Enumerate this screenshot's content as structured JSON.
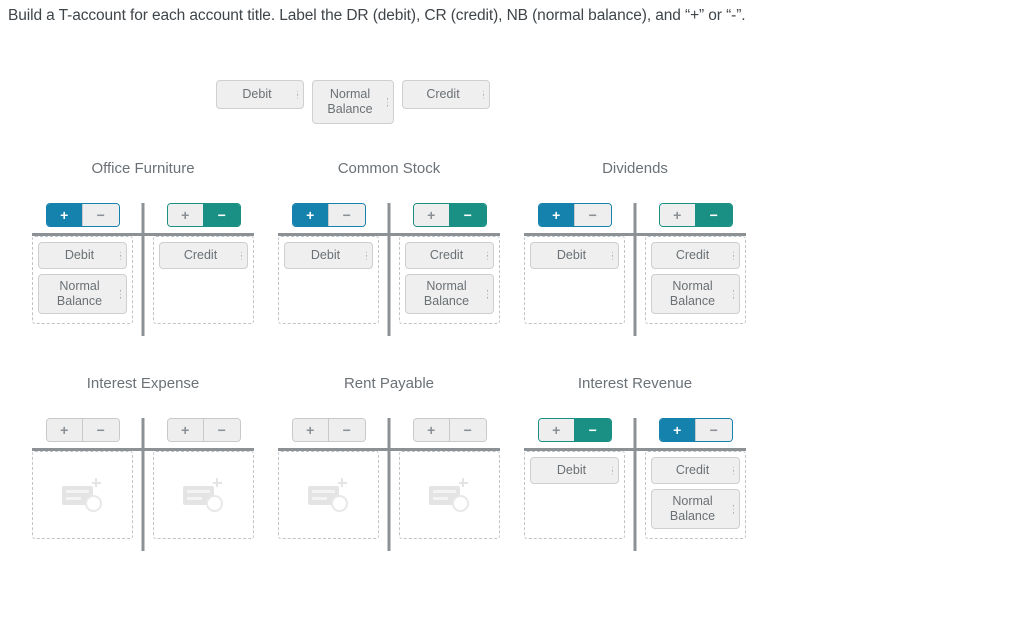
{
  "instruction": "Build a T-account for each account title. Label the DR (debit), CR (credit), NB (normal balance), and “+” or “-”.",
  "colors": {
    "debit_selected": "#1581ad",
    "credit_selected": "#199083",
    "neutral_fill": "#eeeeee",
    "neutral_text": "#8a9095",
    "rule": "#8c9195",
    "token_fill": "#efefef",
    "token_border": "#cfcfcf",
    "dropzone_border": "#c0c4c7"
  },
  "token_bank": {
    "name": "token-bank",
    "tokens": [
      {
        "label": "Debit",
        "two_line": false
      },
      {
        "label": "Normal\nBalance",
        "line1": "Normal",
        "line2": "Balance",
        "two_line": true
      },
      {
        "label": "Credit",
        "two_line": false
      }
    ]
  },
  "toggle": {
    "plus_label": "+",
    "minus_label": "−"
  },
  "placeholder": {
    "icon": "add-token-placeholder-icon"
  },
  "accounts": [
    {
      "title": "Office Furniture",
      "debit": {
        "plus_state": "selected-blue",
        "minus_state": "neutral",
        "tokens": [
          {
            "label": "Debit",
            "two_line": false
          },
          {
            "label": "Normal Balance",
            "line1": "Normal",
            "line2": "Balance",
            "two_line": true
          }
        ]
      },
      "credit": {
        "plus_state": "neutral",
        "minus_state": "selected-teal",
        "tokens": [
          {
            "label": "Credit",
            "two_line": false
          }
        ]
      }
    },
    {
      "title": "Common Stock",
      "debit": {
        "plus_state": "selected-blue",
        "minus_state": "neutral",
        "tokens": [
          {
            "label": "Debit",
            "two_line": false
          }
        ]
      },
      "credit": {
        "plus_state": "neutral",
        "minus_state": "selected-teal",
        "tokens": [
          {
            "label": "Credit",
            "two_line": false
          },
          {
            "label": "Normal Balance",
            "line1": "Normal",
            "line2": "Balance",
            "two_line": true
          }
        ]
      }
    },
    {
      "title": "Dividends",
      "debit": {
        "plus_state": "selected-blue",
        "minus_state": "neutral",
        "tokens": [
          {
            "label": "Debit",
            "two_line": false
          }
        ]
      },
      "credit": {
        "plus_state": "neutral",
        "minus_state": "selected-teal",
        "tokens": [
          {
            "label": "Credit",
            "two_line": false
          },
          {
            "label": "Normal Balance",
            "line1": "Normal",
            "line2": "Balance",
            "two_line": true
          }
        ]
      }
    },
    {
      "title": "Interest Expense",
      "debit": {
        "plus_state": "neutral",
        "minus_state": "neutral",
        "tokens": []
      },
      "credit": {
        "plus_state": "neutral",
        "minus_state": "neutral",
        "tokens": []
      }
    },
    {
      "title": "Rent Payable",
      "debit": {
        "plus_state": "neutral",
        "minus_state": "neutral",
        "tokens": []
      },
      "credit": {
        "plus_state": "neutral",
        "minus_state": "neutral",
        "tokens": []
      }
    },
    {
      "title": "Interest Revenue",
      "debit": {
        "plus_state": "neutral",
        "minus_state": "selected-teal",
        "tokens": [
          {
            "label": "Debit",
            "two_line": false
          }
        ]
      },
      "credit": {
        "plus_state": "selected-blue",
        "minus_state": "neutral",
        "tokens": [
          {
            "label": "Credit",
            "two_line": false
          },
          {
            "label": "Normal Balance",
            "line1": "Normal",
            "line2": "Balance",
            "two_line": true
          }
        ]
      }
    }
  ]
}
